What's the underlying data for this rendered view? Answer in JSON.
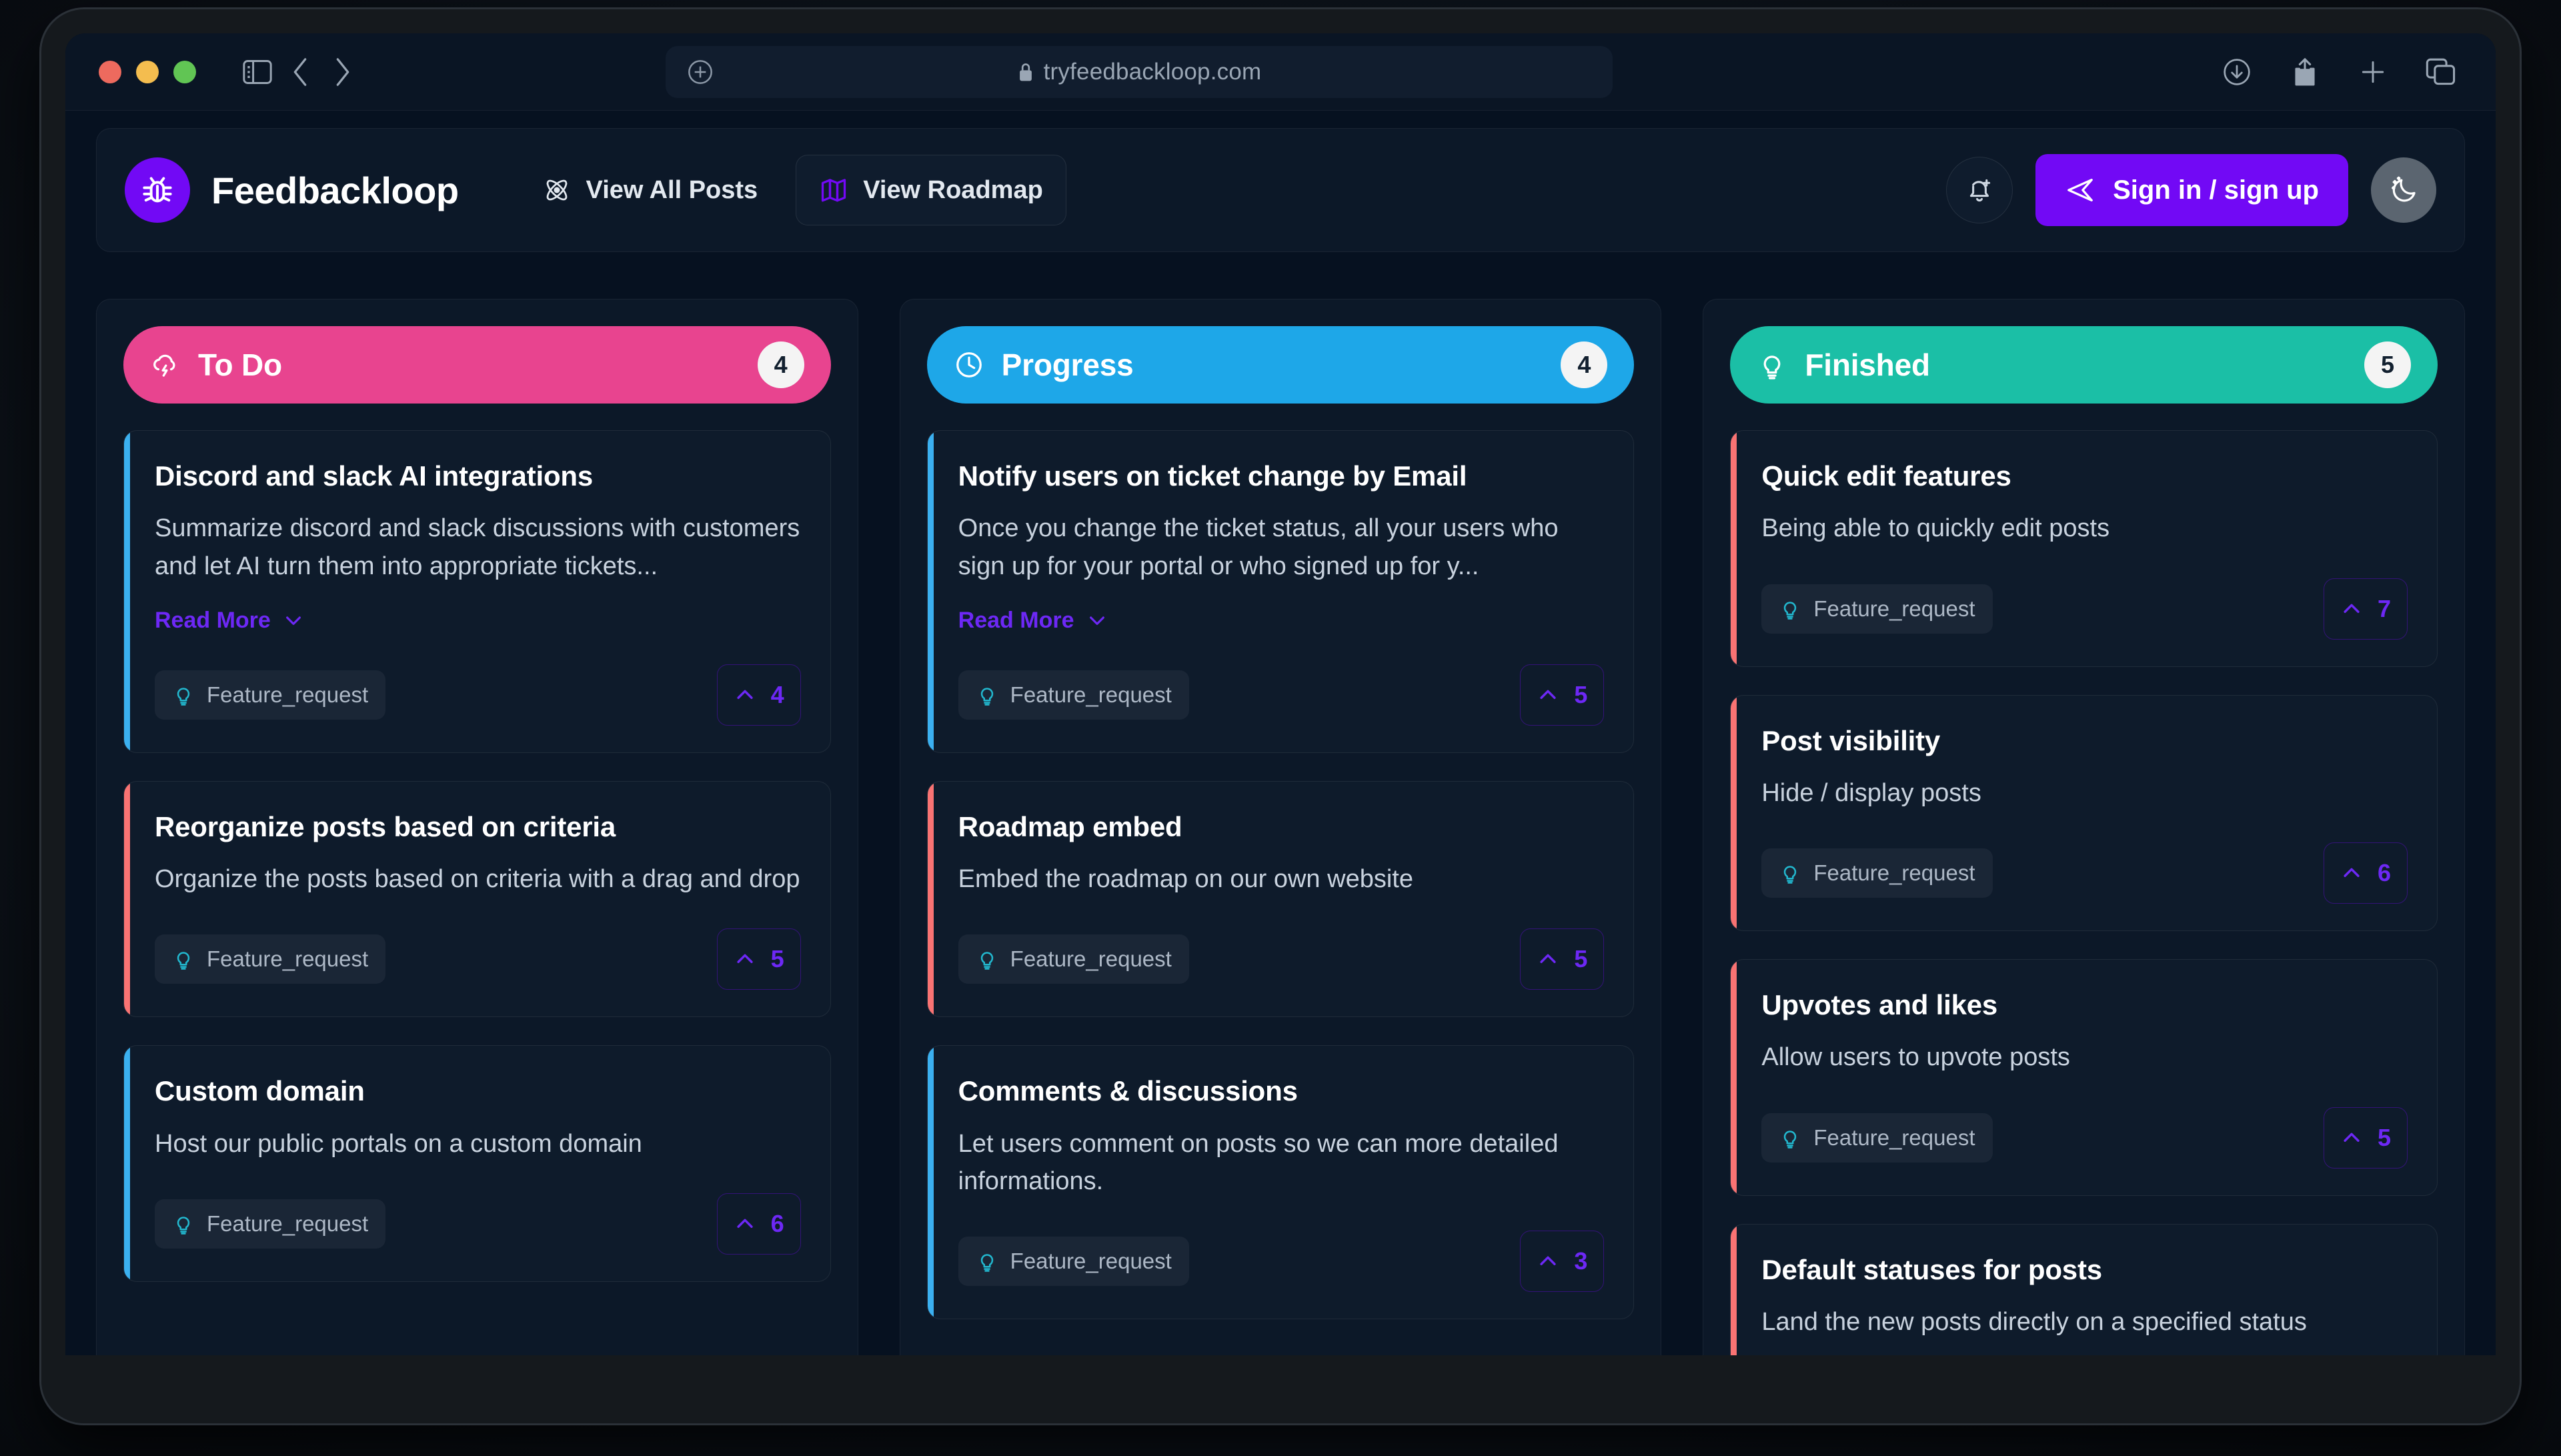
{
  "browser": {
    "traffic_lights": [
      "close",
      "minimize",
      "maximize"
    ],
    "url": "tryfeedbackloop.com",
    "secure": true,
    "left_icons": [
      "sidebar-toggle-icon",
      "back-icon",
      "forward-icon"
    ],
    "right_icons": [
      "download-icon",
      "share-icon",
      "new-tab-icon",
      "tab-overview-icon"
    ],
    "url_plus_icon": "add-circle-icon",
    "lock_icon": "lock-icon"
  },
  "header": {
    "brand_name": "Feedbackloop",
    "brand_icon": "bug-icon",
    "brand_color": "#7209f5",
    "nav": [
      {
        "label": "View All Posts",
        "icon": "atom-icon",
        "active": false
      },
      {
        "label": "View Roadmap",
        "icon": "map-icon",
        "active": true
      }
    ],
    "notifications_icon": "bell-plus-icon",
    "signin_label": "Sign in / sign up",
    "signin_icon": "send-icon",
    "theme_toggle_icon": "moon-stars-icon"
  },
  "board": {
    "columns": [
      {
        "title": "To Do",
        "icon": "cloud-lightning-icon",
        "count": "4",
        "color": "#e8448f",
        "cards": [
          {
            "title": "Discord and slack AI integrations",
            "desc": "Summarize discord and slack discussions with customers and let AI turn them into appropriate tickets...",
            "read_more": "Read More",
            "tag": "Feature_request",
            "tag_icon": "lightbulb-icon",
            "upvotes": "4",
            "accent": "#3bb0f0"
          },
          {
            "title": "Reorganize posts based on criteria",
            "desc": "Organize the posts based on criteria with a drag and drop",
            "read_more": null,
            "tag": "Feature_request",
            "tag_icon": "lightbulb-icon",
            "upvotes": "5",
            "accent": "#f97373"
          },
          {
            "title": "Custom domain",
            "desc": "Host our public portals on a custom domain",
            "read_more": null,
            "tag": "Feature_request",
            "tag_icon": "lightbulb-icon",
            "upvotes": "6",
            "accent": "#3bb0f0"
          }
        ]
      },
      {
        "title": "Progress",
        "icon": "clock-icon",
        "count": "4",
        "color": "#1ea7e8",
        "cards": [
          {
            "title": "Notify users on ticket change by Email",
            "desc": "Once you change the ticket status, all your users who sign up for your portal or who signed up for y...",
            "read_more": "Read More",
            "tag": "Feature_request",
            "tag_icon": "lightbulb-icon",
            "upvotes": "5",
            "accent": "#3bb0f0"
          },
          {
            "title": "Roadmap embed",
            "desc": "Embed the roadmap on our own website",
            "read_more": null,
            "tag": "Feature_request",
            "tag_icon": "lightbulb-icon",
            "upvotes": "5",
            "accent": "#f97373"
          },
          {
            "title": "Comments & discussions",
            "desc": "Let users comment on posts so we can more detailed informations.",
            "read_more": null,
            "tag": "Feature_request",
            "tag_icon": "lightbulb-icon",
            "upvotes": "3",
            "accent": "#3bb0f0"
          }
        ]
      },
      {
        "title": "Finished",
        "icon": "lightbulb-icon",
        "count": "5",
        "color": "#1bbfa6",
        "cards": [
          {
            "title": "Quick edit features",
            "desc": "Being able to quickly edit posts",
            "read_more": null,
            "tag": "Feature_request",
            "tag_icon": "lightbulb-icon",
            "upvotes": "7",
            "accent": "#f97373"
          },
          {
            "title": "Post visibility",
            "desc": "Hide / display posts",
            "read_more": null,
            "tag": "Feature_request",
            "tag_icon": "lightbulb-icon",
            "upvotes": "6",
            "accent": "#f97373"
          },
          {
            "title": "Upvotes and likes",
            "desc": "Allow users to upvote posts",
            "read_more": null,
            "tag": "Feature_request",
            "tag_icon": "lightbulb-icon",
            "upvotes": "5",
            "accent": "#f97373"
          },
          {
            "title": "Default statuses for posts",
            "desc": "Land the new posts directly on a specified status",
            "read_more": null,
            "tag": null,
            "tag_icon": null,
            "upvotes": null,
            "accent": "#f97373"
          }
        ]
      }
    ]
  }
}
